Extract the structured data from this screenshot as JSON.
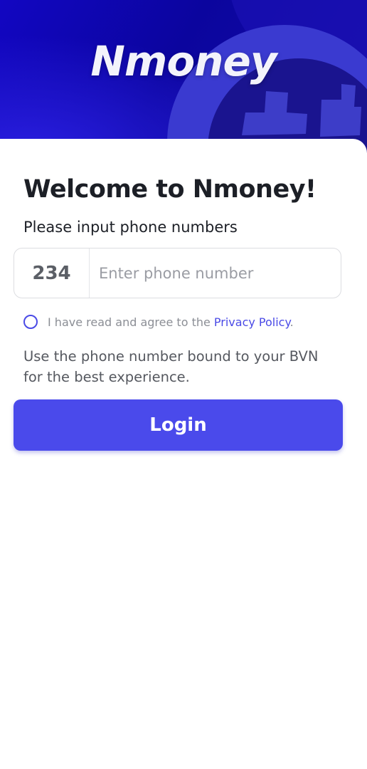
{
  "header": {
    "logo_text": "Nmoney"
  },
  "welcome": {
    "title": "Welcome to Nmoney!",
    "subtitle": "Please input phone numbers"
  },
  "phone": {
    "country_code": "234",
    "placeholder": "Enter phone number",
    "value": ""
  },
  "agreement": {
    "text": "I have read and agree to the ",
    "link_text": "Privacy Policy",
    "suffix": ".",
    "checked": false
  },
  "hint": "Use the phone number bound to your BVN for the best experience.",
  "login_button": "Login",
  "colors": {
    "brand_dark": "#0b059e",
    "accent": "#4a4aeb",
    "text_dark": "#1c1f26"
  }
}
